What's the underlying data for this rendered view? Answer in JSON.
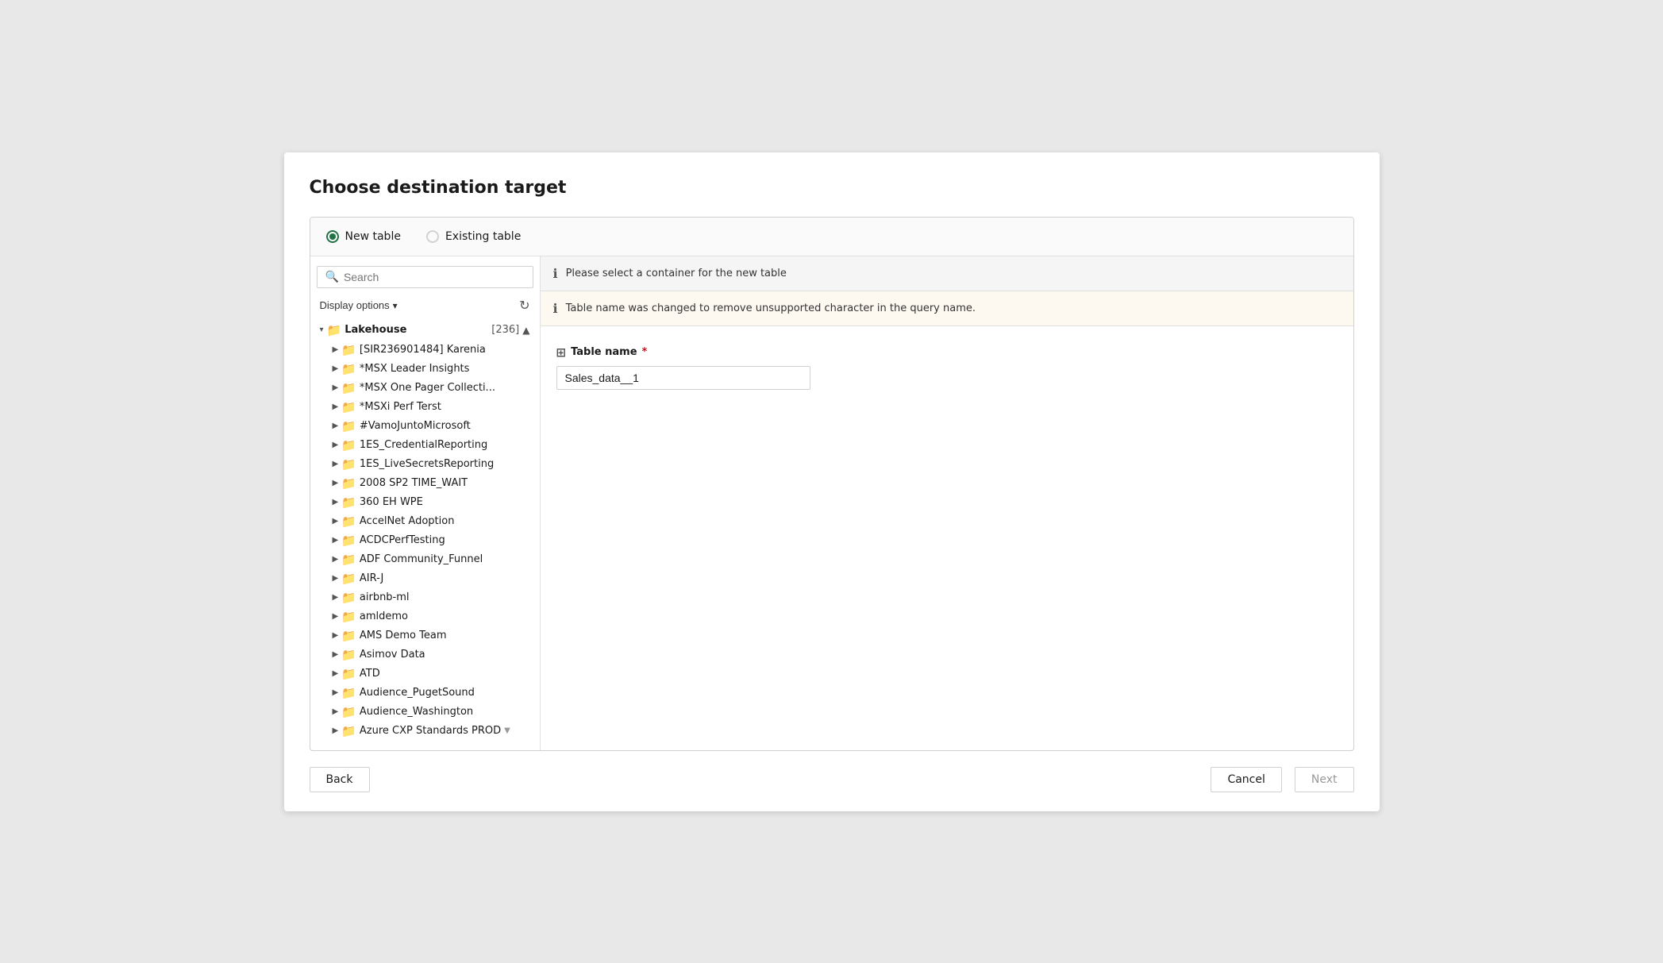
{
  "dialog": {
    "title": "Choose destination target"
  },
  "radio": {
    "options": [
      {
        "id": "new-table",
        "label": "New table",
        "selected": true
      },
      {
        "id": "existing-table",
        "label": "Existing table",
        "selected": false
      }
    ]
  },
  "search": {
    "placeholder": "Search",
    "value": ""
  },
  "display_options": {
    "label": "Display options"
  },
  "tree": {
    "root": {
      "label": "Lakehouse",
      "count": "[236]"
    },
    "items": [
      {
        "label": "[SIR236901484] Karenia"
      },
      {
        "label": "*MSX Leader Insights"
      },
      {
        "label": "*MSX One Pager Collecti..."
      },
      {
        "label": "*MSXi Perf Terst"
      },
      {
        "label": "#VamoJuntoMicrosoft"
      },
      {
        "label": "1ES_CredentialReporting"
      },
      {
        "label": "1ES_LiveSecretsReporting"
      },
      {
        "label": "2008 SP2 TIME_WAIT"
      },
      {
        "label": "360 EH WPE"
      },
      {
        "label": "AccelNet Adoption"
      },
      {
        "label": "ACDCPerfTesting"
      },
      {
        "label": "ADF Community_Funnel"
      },
      {
        "label": "AIR-J"
      },
      {
        "label": "airbnb-ml"
      },
      {
        "label": "amldemo"
      },
      {
        "label": "AMS Demo Team"
      },
      {
        "label": "Asimov Data"
      },
      {
        "label": "ATD"
      },
      {
        "label": "Audience_PugetSound"
      },
      {
        "label": "Audience_Washington"
      },
      {
        "label": "Azure CXP Standards PROD"
      }
    ]
  },
  "banners": {
    "info": "Please select a container for the new table",
    "warning": "Table name was changed to remove unsupported character in the query name."
  },
  "form": {
    "table_name_label": "Table name",
    "table_name_value": "Sales_data__1",
    "required": "*"
  },
  "footer": {
    "back_label": "Back",
    "cancel_label": "Cancel",
    "next_label": "Next"
  }
}
